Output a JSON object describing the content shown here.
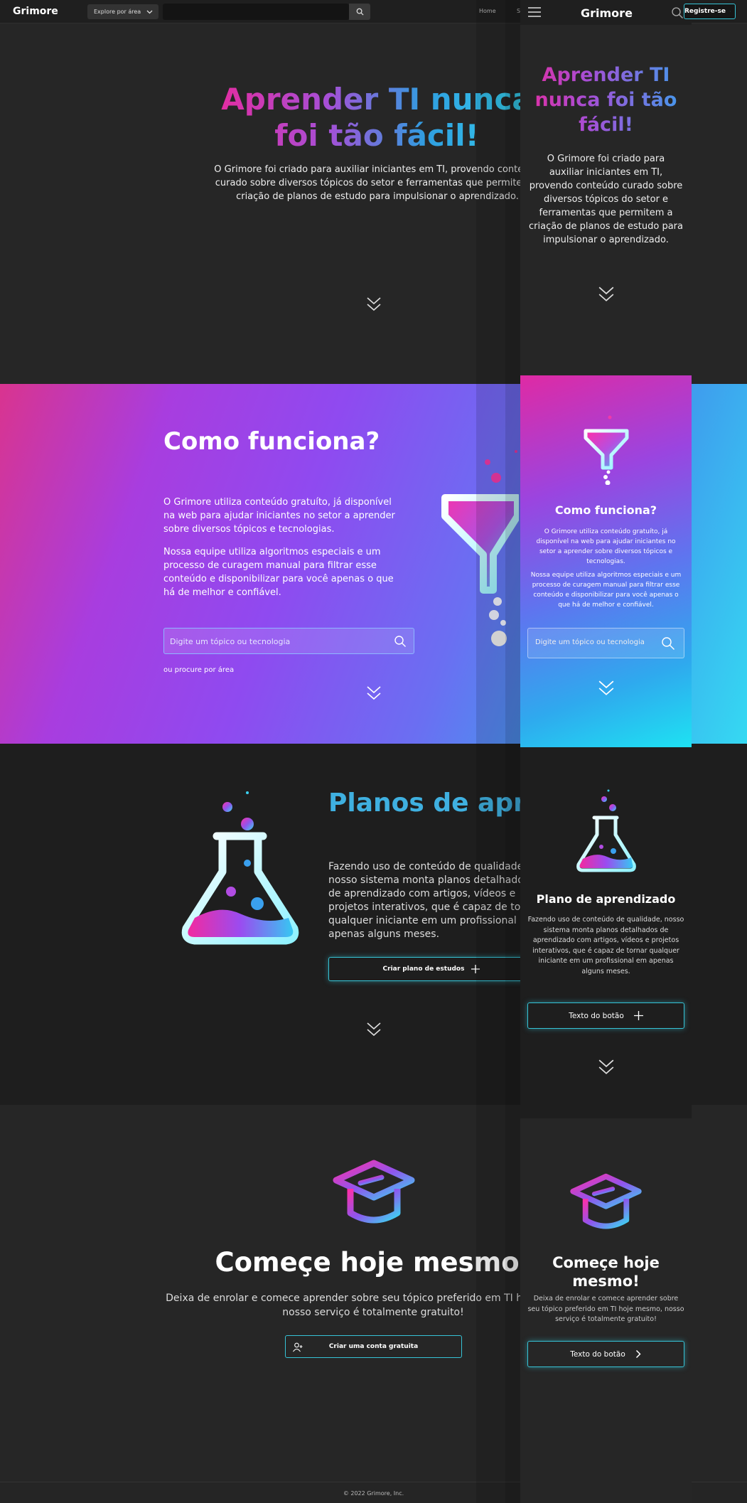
{
  "desktop": {
    "brand": "Grimore",
    "explore_label": "Explore por área",
    "nav": {
      "home": "Home",
      "partial": "S"
    },
    "hero": {
      "title": "Aprender TI nunca foi tão fácil!",
      "subtitle": "O Grimore foi criado para auxiliar  iniciantes em TI, provendo conteúdo curado sobre diversos tópicos do setor e ferramentas que permitem a criação de planos de estudo para impulsionar o aprendizado."
    },
    "how": {
      "title": "Como funciona?",
      "p1": "O Grimore utiliza conteúdo gratuíto, já disponível na web para ajudar iniciantes no setor a aprender sobre diversos tópicos e tecnologias.",
      "p2": "Nossa equipe utiliza algoritmos especiais e um processo de curagem manual para filtrar esse conteúdo e disponibilizar para você apenas o que há de melhor e confiável.",
      "search_placeholder": "Digite um tópico ou tecnologia",
      "area_link": "ou procure por área"
    },
    "plans": {
      "title": "Planos de aprendizado",
      "text": "Fazendo uso de conteúdo de qualidade, nosso sistema monta planos detalhados de aprendizado com artigos, vídeos e projetos interativos, que é capaz de tornar qualquer iniciante em um profissional em apenas alguns meses.",
      "button": "Criar plano de estudos"
    },
    "start": {
      "title": "Começe hoje mesmo!",
      "text": "Deixa de enrolar e comece aprender sobre seu tópico preferido em TI hoje mesmo, nosso serviço é totalmente gratuito!",
      "button": "Criar uma conta gratuita"
    },
    "footer": "© 2022 Grimore, Inc."
  },
  "mobile": {
    "brand": "Grimore",
    "register_label": "Registre-se",
    "hero": {
      "title": "Aprender TI nunca foi tão fácil!",
      "subtitle": "O Grimore foi criado para auxiliar iniciantes em TI, provendo conteúdo curado sobre diversos tópicos do setor e ferramentas que permitem a criação de planos de estudo para impulsionar o aprendizado."
    },
    "how": {
      "title": "Como funciona?",
      "p1": "O Grimore utiliza conteúdo gratuíto, já disponível na web para ajudar iniciantes no setor a aprender sobre diversos tópicos e tecnologias.",
      "p2": "Nossa equipe utiliza algoritmos especiais e um processo de curagem manual para filtrar esse conteúdo e disponibilizar para você apenas o que há  de melhor e confiável.",
      "search_placeholder": "Digite um tópico ou tecnologia"
    },
    "plans": {
      "title": "Plano de aprendizado",
      "text": "Fazendo uso de conteúdo de qualidade, nosso sistema monta planos detalhados de aprendizado com artigos, vídeos e projetos interativos, que é capaz de tornar qualquer iniciante em um profissional em apenas alguns meses.",
      "button": "Texto do botão"
    },
    "start": {
      "title": "Começe hoje mesmo!",
      "text": "Deixa de enrolar e comece aprender sobre seu tópico preferido em TI hoje mesmo, nosso serviço é totalmente gratuito!",
      "button": "Texto do botão"
    }
  },
  "colors": {
    "pink": "#e62b9f",
    "purple": "#9a45e0",
    "cyan": "#36d6ef",
    "plans_title": "#3fb0e0",
    "button_border": "#36c3d6"
  },
  "icons": [
    "search-icon",
    "chevron-down-icon",
    "chevron-double-down-icon",
    "funnel-icon",
    "flask-icon",
    "graduation-cap-icon",
    "add-user-icon",
    "plus-icon",
    "menu-icon",
    "chevron-right-icon"
  ]
}
